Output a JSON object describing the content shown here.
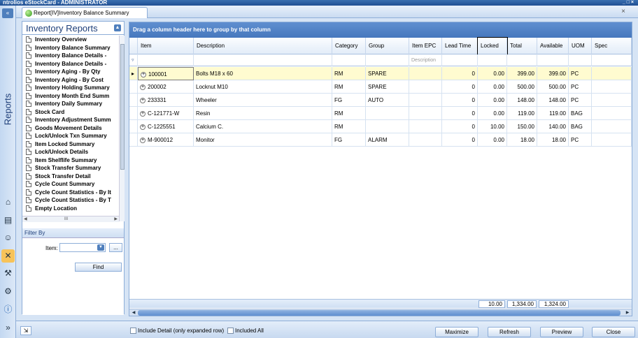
{
  "window": {
    "title": "ntrolios eStockCard - ADMINISTRATOR",
    "controls": "_ □ ×"
  },
  "tab": {
    "label": "Report[IV]Inventory Balance Summary",
    "close": "×"
  },
  "sidebar": {
    "vertical_label": "Reports",
    "top_button": "«",
    "expand": "»"
  },
  "reports_panel": {
    "title": "Inventory Reports",
    "items": [
      "Inventory Overview",
      "Inventory Balance Summary",
      "Inventory Balance Details - ",
      "Inventory Balance Details - ",
      "Inventory Aging - By Qty",
      "Inventory Aging - By Cost",
      "Inventory Holding Summary",
      "Inventory Month End Summ",
      "Inventory Daily Summary",
      "Stock Card",
      "Inventory Adjustment Summ",
      "Goods Movement Details",
      "Lock/Unlock Txn Summary",
      "Item Locked Summary",
      "Lock/Unlock Details",
      "Item Shelflife Summary",
      "Stock Transfer Summary",
      "Stock Transfer Detail",
      "Cycle Count Summary",
      "Cycle Count Statistics - By It",
      "Cycle Count Statistics - By T",
      "Empty Location"
    ],
    "hscroll_label": "III"
  },
  "filter": {
    "header": "Filter By",
    "item_label": "Item:",
    "item_value": "",
    "browse_label": "...",
    "find_label": "Find"
  },
  "grid": {
    "group_hint": "Drag a column header here to group by that column",
    "columns": [
      "Item",
      "Description",
      "Category",
      "Group",
      "Item EPC",
      "Lead Time",
      "Locked",
      "Total",
      "Available",
      "UOM",
      "Spec"
    ],
    "filter_placeholder_epc": "Description",
    "rows": [
      {
        "item": "100001",
        "description": "Bolts M18 x 60",
        "category": "RM",
        "group": "SPARE",
        "epc": "",
        "lead": "0",
        "locked": "0.00",
        "total": "399.00",
        "available": "399.00",
        "uom": "PC",
        "spec": ""
      },
      {
        "item": "200002",
        "description": "Locknut M10",
        "category": "RM",
        "group": "SPARE",
        "epc": "",
        "lead": "0",
        "locked": "0.00",
        "total": "500.00",
        "available": "500.00",
        "uom": "PC",
        "spec": ""
      },
      {
        "item": "233331",
        "description": "Wheeler",
        "category": "FG",
        "group": "AUTO",
        "epc": "",
        "lead": "0",
        "locked": "0.00",
        "total": "148.00",
        "available": "148.00",
        "uom": "PC",
        "spec": ""
      },
      {
        "item": "C-121771-W",
        "description": "Resin",
        "category": "RM",
        "group": "",
        "epc": "",
        "lead": "0",
        "locked": "0.00",
        "total": "119.00",
        "available": "119.00",
        "uom": "BAG",
        "spec": ""
      },
      {
        "item": "C-1225551",
        "description": "Calcium C.",
        "category": "RM",
        "group": "",
        "epc": "",
        "lead": "0",
        "locked": "10.00",
        "total": "150.00",
        "available": "140.00",
        "uom": "BAG",
        "spec": ""
      },
      {
        "item": "M-900012",
        "description": "Monitor",
        "category": "FG",
        "group": "ALARM",
        "epc": "",
        "lead": "0",
        "locked": "0.00",
        "total": "18.00",
        "available": "18.00",
        "uom": "PC",
        "spec": ""
      }
    ],
    "totals": {
      "locked": "10.00",
      "total": "1,334.00",
      "available": "1,324.00"
    }
  },
  "bottom": {
    "include_detail": "Include Detail (only expanded row)",
    "included_all": "Included All",
    "maximize": "Maximize",
    "refresh": "Refresh",
    "preview": "Preview",
    "close": "Close"
  }
}
